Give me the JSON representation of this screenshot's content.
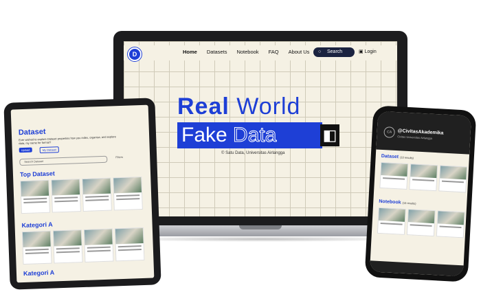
{
  "laptop": {
    "nav": {
      "links": [
        "Home",
        "Datasets",
        "Notebook",
        "FAQ",
        "About Us"
      ],
      "search_label": "Search",
      "login_label": "Login"
    },
    "hero": {
      "line1_a": "Real",
      "line1_b": "World",
      "line2_a": "Fake",
      "line2_b": "Data",
      "copyright": "© Satu Data, Universitas Airlangga"
    }
  },
  "tablet": {
    "title": "Dataset",
    "subtitle": "Ever wished to explore Dataset properties how you index, organise, and explore data, my name for format?",
    "upload_label": "Upload",
    "my_dataset_label": "My Dataset",
    "search_placeholder": "Search Dataset",
    "filters_label": "Filters",
    "section_top": "Top Dataset",
    "section_kat1": "Kategori A",
    "section_kat2": "Kategori A"
  },
  "phone": {
    "avatar_initials": "CA",
    "handle": "@CivitasAkademika",
    "handle_sub": "Civitas Universitas Airlangga",
    "section_dataset": "Dataset",
    "dataset_count": "(10 results)",
    "section_notebook": "Notebook",
    "notebook_count": "(10 results)"
  },
  "colors": {
    "accent": "#1e3fd6",
    "background": "#f5f1e4",
    "device": "#1c1c1e"
  },
  "icons": [
    "logo-icon",
    "search-icon",
    "user-icon",
    "globe-icon",
    "ai-icon"
  ]
}
